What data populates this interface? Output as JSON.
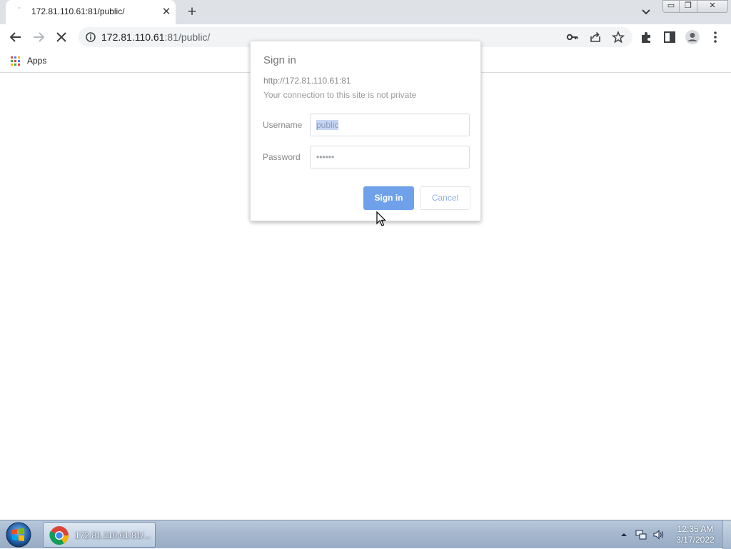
{
  "browser": {
    "tab": {
      "title": "172.81.110.61:81/public/",
      "close_glyph": "✕"
    },
    "new_tab_glyph": "+",
    "window_controls": {
      "minimize": "▭",
      "maximize": "❐",
      "close": "✕"
    },
    "address": {
      "host": "172.81.110.61",
      "rest": ":81/public/"
    },
    "bookmarks": [
      {
        "label": "Apps"
      }
    ],
    "icons": [
      "back-arrow-icon",
      "forward-arrow-icon",
      "stop-loading-icon",
      "info-icon",
      "key-icon",
      "share-icon",
      "star-icon",
      "extensions-icon",
      "side-panel-icon",
      "profile-icon",
      "menu-icon"
    ]
  },
  "dialog": {
    "title": "Sign in",
    "origin": "http://172.81.110.61:81",
    "note": "Your connection to this site is not private",
    "username": {
      "label": "Username",
      "value": "public"
    },
    "password": {
      "label": "Password",
      "value": "••••••"
    },
    "submit_label": "Sign in",
    "cancel_label": "Cancel"
  },
  "taskbar": {
    "items": [
      {
        "label": "172.81.110.61:81/..."
      }
    ],
    "clock": {
      "time": "12:35 AM",
      "date": "3/17/2022"
    },
    "tray_icons": [
      "show-hidden-icons-icon",
      "network-icon",
      "volume-icon"
    ]
  },
  "colors": {
    "primary_button": "#6fa1ea",
    "selection": "#c5d6f2",
    "taskbar": "#a7b9cf"
  }
}
